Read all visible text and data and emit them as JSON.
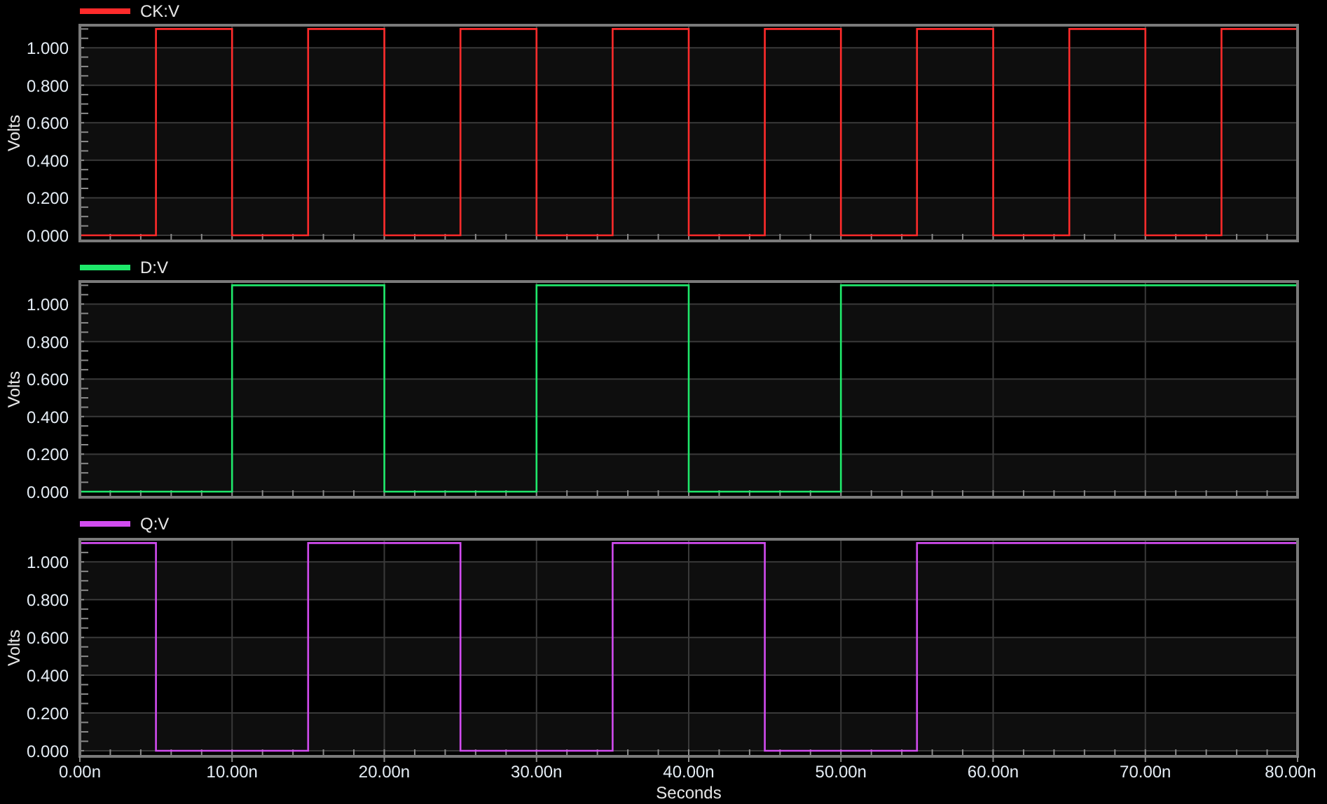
{
  "charts": [
    {
      "chart_data": {
        "type": "line",
        "grid": true,
        "ylabel": "Volts",
        "x": [
          0,
          5,
          5,
          10,
          10,
          15,
          15,
          20,
          20,
          25,
          25,
          30,
          30,
          35,
          35,
          40,
          40,
          45,
          45,
          50,
          50,
          55,
          55,
          60,
          60,
          65,
          65,
          70,
          70,
          75,
          75,
          80
        ],
        "xlim": [
          0,
          80
        ],
        "ylim": [
          -0.03,
          1.12
        ],
        "yticks": [
          {
            "value": 0,
            "label": "0.000"
          },
          {
            "value": 0.2,
            "label": "0.200"
          },
          {
            "value": 0.4,
            "label": "0.400"
          },
          {
            "value": 0.6,
            "label": "0.600"
          },
          {
            "value": 0.8,
            "label": "0.800"
          },
          {
            "value": 1,
            "label": "1.000"
          }
        ],
        "series": [
          {
            "name": "CK:V",
            "color": "#ff2b2b",
            "values": [
              0,
              0,
              1.1,
              1.1,
              0,
              0,
              1.1,
              1.1,
              0,
              0,
              1.1,
              1.1,
              0,
              0,
              1.1,
              1.1,
              0,
              0,
              1.1,
              1.1,
              0,
              0,
              1.1,
              1.1,
              0,
              0,
              1.1,
              1.1,
              0,
              0,
              1.1,
              1.1
            ]
          }
        ]
      }
    },
    {
      "chart_data": {
        "type": "line",
        "grid": true,
        "ylabel": "Volts",
        "x": [
          0,
          10,
          10,
          20,
          20,
          30,
          30,
          40,
          40,
          50,
          50,
          80
        ],
        "xlim": [
          0,
          80
        ],
        "ylim": [
          -0.03,
          1.12
        ],
        "yticks": [
          {
            "value": 0,
            "label": "0.000"
          },
          {
            "value": 0.2,
            "label": "0.200"
          },
          {
            "value": 0.4,
            "label": "0.400"
          },
          {
            "value": 0.6,
            "label": "0.600"
          },
          {
            "value": 0.8,
            "label": "0.800"
          },
          {
            "value": 1,
            "label": "1.000"
          }
        ],
        "series": [
          {
            "name": "D:V",
            "color": "#1ee86a",
            "values": [
              0,
              0,
              1.1,
              1.1,
              0,
              0,
              1.1,
              1.1,
              0,
              0,
              1.1,
              1.1
            ]
          }
        ]
      }
    },
    {
      "chart_data": {
        "type": "line",
        "grid": true,
        "xlabel": "Seconds",
        "ylabel": "Volts",
        "x": [
          0,
          5,
          5,
          15,
          15,
          25,
          25,
          35,
          35,
          45,
          45,
          55,
          55,
          80
        ],
        "xlim": [
          0,
          80
        ],
        "ylim": [
          -0.03,
          1.12
        ],
        "xticks": [
          {
            "value": 0,
            "label": "0.00n"
          },
          {
            "value": 10,
            "label": "10.00n"
          },
          {
            "value": 20,
            "label": "20.00n"
          },
          {
            "value": 30,
            "label": "30.00n"
          },
          {
            "value": 40,
            "label": "40.00n"
          },
          {
            "value": 50,
            "label": "50.00n"
          },
          {
            "value": 60,
            "label": "60.00n"
          },
          {
            "value": 70,
            "label": "70.00n"
          },
          {
            "value": 80,
            "label": "80.00n"
          }
        ],
        "yticks": [
          {
            "value": 0,
            "label": "0.000"
          },
          {
            "value": 0.2,
            "label": "0.200"
          },
          {
            "value": 0.4,
            "label": "0.400"
          },
          {
            "value": 0.6,
            "label": "0.600"
          },
          {
            "value": 0.8,
            "label": "0.800"
          },
          {
            "value": 1,
            "label": "1.000"
          }
        ],
        "series": [
          {
            "name": "Q:V",
            "color": "#d24cf0",
            "values": [
              1.1,
              1.1,
              0,
              0,
              1.1,
              1.1,
              0,
              0,
              1.1,
              1.1,
              0,
              0,
              1.1,
              1.1
            ]
          }
        ]
      }
    }
  ]
}
